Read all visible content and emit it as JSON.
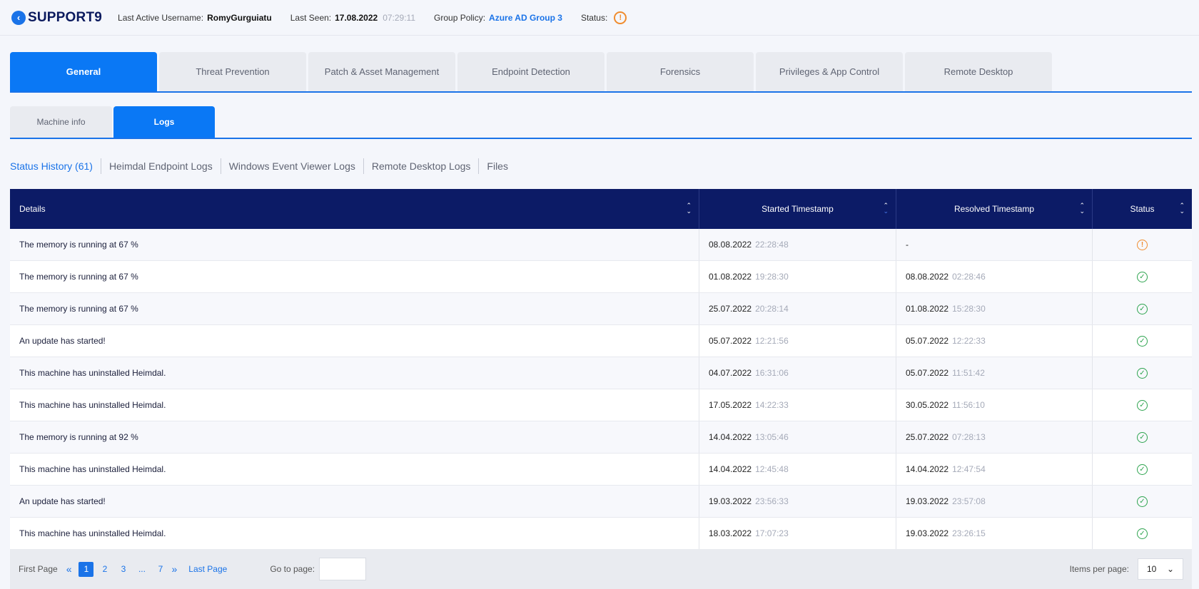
{
  "header": {
    "hostname": "SUPPORT9",
    "username_label": "Last Active Username:",
    "username": "RomyGurguiatu",
    "last_seen_label": "Last Seen:",
    "last_seen_date": "17.08.2022",
    "last_seen_time": "07:29:11",
    "group_policy_label": "Group Policy:",
    "group_policy": "Azure AD Group 3",
    "status_label": "Status:"
  },
  "main_tabs": [
    "General",
    "Threat Prevention",
    "Patch & Asset Management",
    "Endpoint Detection",
    "Forensics",
    "Privileges & App Control",
    "Remote Desktop"
  ],
  "sub_tabs": [
    "Machine info",
    "Logs"
  ],
  "log_tabs": [
    "Status History (61)",
    "Heimdal Endpoint Logs",
    "Windows Event Viewer Logs",
    "Remote Desktop Logs",
    "Files"
  ],
  "table": {
    "columns": [
      "Details",
      "Started Timestamp",
      "Resolved Timestamp",
      "Status"
    ],
    "rows": [
      {
        "details": "The memory is running at 67 %",
        "start_date": "08.08.2022",
        "start_time": "22:28:48",
        "end_date": "-",
        "end_time": "",
        "status": "warning"
      },
      {
        "details": "The memory is running at 67 %",
        "start_date": "01.08.2022",
        "start_time": "19:28:30",
        "end_date": "08.08.2022",
        "end_time": "02:28:46",
        "status": "resolved"
      },
      {
        "details": "The memory is running at 67 %",
        "start_date": "25.07.2022",
        "start_time": "20:28:14",
        "end_date": "01.08.2022",
        "end_time": "15:28:30",
        "status": "resolved"
      },
      {
        "details": "An update has started!",
        "start_date": "05.07.2022",
        "start_time": "12:21:56",
        "end_date": "05.07.2022",
        "end_time": "12:22:33",
        "status": "resolved"
      },
      {
        "details": "This machine has uninstalled Heimdal.",
        "start_date": "04.07.2022",
        "start_time": "16:31:06",
        "end_date": "05.07.2022",
        "end_time": "11:51:42",
        "status": "resolved"
      },
      {
        "details": "This machine has uninstalled Heimdal.",
        "start_date": "17.05.2022",
        "start_time": "14:22:33",
        "end_date": "30.05.2022",
        "end_time": "11:56:10",
        "status": "resolved"
      },
      {
        "details": "The memory is running at 92 %",
        "start_date": "14.04.2022",
        "start_time": "13:05:46",
        "end_date": "25.07.2022",
        "end_time": "07:28:13",
        "status": "resolved"
      },
      {
        "details": "This machine has uninstalled Heimdal.",
        "start_date": "14.04.2022",
        "start_time": "12:45:48",
        "end_date": "14.04.2022",
        "end_time": "12:47:54",
        "status": "resolved"
      },
      {
        "details": "An update has started!",
        "start_date": "19.03.2022",
        "start_time": "23:56:33",
        "end_date": "19.03.2022",
        "end_time": "23:57:08",
        "status": "resolved"
      },
      {
        "details": "This machine has uninstalled Heimdal.",
        "start_date": "18.03.2022",
        "start_time": "17:07:23",
        "end_date": "19.03.2022",
        "end_time": "23:26:15",
        "status": "resolved"
      }
    ]
  },
  "pager": {
    "first_label": "First Page",
    "pages": [
      "1",
      "2",
      "3",
      "...",
      "7"
    ],
    "current_page": "1",
    "last_label": "Last Page",
    "goto_label": "Go to page:",
    "items_per_page_label": "Items per page:",
    "items_per_page": "10"
  },
  "icons": {
    "back": "chevron-left-icon",
    "warning": "exclamation-circle-icon",
    "resolved": "check-circle-icon",
    "sort": "sort-arrows-icon"
  },
  "colors": {
    "accent": "#0a78f5",
    "header_navy": "#0c1b66",
    "warning": "#f08c2e",
    "success": "#2ea44f"
  }
}
